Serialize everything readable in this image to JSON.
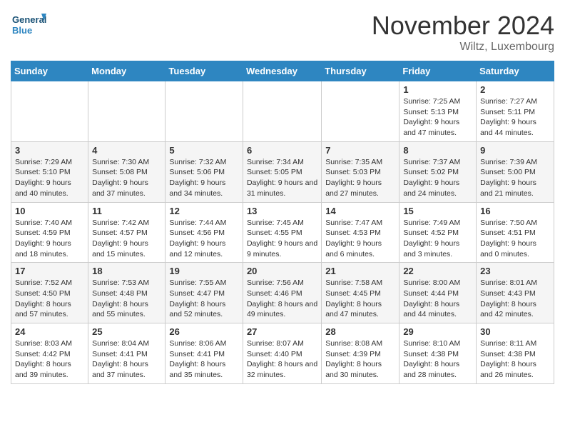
{
  "header": {
    "logo_line1": "General",
    "logo_line2": "Blue",
    "month_title": "November 2024",
    "location": "Wiltz, Luxembourg"
  },
  "weekdays": [
    "Sunday",
    "Monday",
    "Tuesday",
    "Wednesday",
    "Thursday",
    "Friday",
    "Saturday"
  ],
  "weeks": [
    [
      {
        "day": "",
        "info": ""
      },
      {
        "day": "",
        "info": ""
      },
      {
        "day": "",
        "info": ""
      },
      {
        "day": "",
        "info": ""
      },
      {
        "day": "",
        "info": ""
      },
      {
        "day": "1",
        "info": "Sunrise: 7:25 AM\nSunset: 5:13 PM\nDaylight: 9 hours and 47 minutes."
      },
      {
        "day": "2",
        "info": "Sunrise: 7:27 AM\nSunset: 5:11 PM\nDaylight: 9 hours and 44 minutes."
      }
    ],
    [
      {
        "day": "3",
        "info": "Sunrise: 7:29 AM\nSunset: 5:10 PM\nDaylight: 9 hours and 40 minutes."
      },
      {
        "day": "4",
        "info": "Sunrise: 7:30 AM\nSunset: 5:08 PM\nDaylight: 9 hours and 37 minutes."
      },
      {
        "day": "5",
        "info": "Sunrise: 7:32 AM\nSunset: 5:06 PM\nDaylight: 9 hours and 34 minutes."
      },
      {
        "day": "6",
        "info": "Sunrise: 7:34 AM\nSunset: 5:05 PM\nDaylight: 9 hours and 31 minutes."
      },
      {
        "day": "7",
        "info": "Sunrise: 7:35 AM\nSunset: 5:03 PM\nDaylight: 9 hours and 27 minutes."
      },
      {
        "day": "8",
        "info": "Sunrise: 7:37 AM\nSunset: 5:02 PM\nDaylight: 9 hours and 24 minutes."
      },
      {
        "day": "9",
        "info": "Sunrise: 7:39 AM\nSunset: 5:00 PM\nDaylight: 9 hours and 21 minutes."
      }
    ],
    [
      {
        "day": "10",
        "info": "Sunrise: 7:40 AM\nSunset: 4:59 PM\nDaylight: 9 hours and 18 minutes."
      },
      {
        "day": "11",
        "info": "Sunrise: 7:42 AM\nSunset: 4:57 PM\nDaylight: 9 hours and 15 minutes."
      },
      {
        "day": "12",
        "info": "Sunrise: 7:44 AM\nSunset: 4:56 PM\nDaylight: 9 hours and 12 minutes."
      },
      {
        "day": "13",
        "info": "Sunrise: 7:45 AM\nSunset: 4:55 PM\nDaylight: 9 hours and 9 minutes."
      },
      {
        "day": "14",
        "info": "Sunrise: 7:47 AM\nSunset: 4:53 PM\nDaylight: 9 hours and 6 minutes."
      },
      {
        "day": "15",
        "info": "Sunrise: 7:49 AM\nSunset: 4:52 PM\nDaylight: 9 hours and 3 minutes."
      },
      {
        "day": "16",
        "info": "Sunrise: 7:50 AM\nSunset: 4:51 PM\nDaylight: 9 hours and 0 minutes."
      }
    ],
    [
      {
        "day": "17",
        "info": "Sunrise: 7:52 AM\nSunset: 4:50 PM\nDaylight: 8 hours and 57 minutes."
      },
      {
        "day": "18",
        "info": "Sunrise: 7:53 AM\nSunset: 4:48 PM\nDaylight: 8 hours and 55 minutes."
      },
      {
        "day": "19",
        "info": "Sunrise: 7:55 AM\nSunset: 4:47 PM\nDaylight: 8 hours and 52 minutes."
      },
      {
        "day": "20",
        "info": "Sunrise: 7:56 AM\nSunset: 4:46 PM\nDaylight: 8 hours and 49 minutes."
      },
      {
        "day": "21",
        "info": "Sunrise: 7:58 AM\nSunset: 4:45 PM\nDaylight: 8 hours and 47 minutes."
      },
      {
        "day": "22",
        "info": "Sunrise: 8:00 AM\nSunset: 4:44 PM\nDaylight: 8 hours and 44 minutes."
      },
      {
        "day": "23",
        "info": "Sunrise: 8:01 AM\nSunset: 4:43 PM\nDaylight: 8 hours and 42 minutes."
      }
    ],
    [
      {
        "day": "24",
        "info": "Sunrise: 8:03 AM\nSunset: 4:42 PM\nDaylight: 8 hours and 39 minutes."
      },
      {
        "day": "25",
        "info": "Sunrise: 8:04 AM\nSunset: 4:41 PM\nDaylight: 8 hours and 37 minutes."
      },
      {
        "day": "26",
        "info": "Sunrise: 8:06 AM\nSunset: 4:41 PM\nDaylight: 8 hours and 35 minutes."
      },
      {
        "day": "27",
        "info": "Sunrise: 8:07 AM\nSunset: 4:40 PM\nDaylight: 8 hours and 32 minutes."
      },
      {
        "day": "28",
        "info": "Sunrise: 8:08 AM\nSunset: 4:39 PM\nDaylight: 8 hours and 30 minutes."
      },
      {
        "day": "29",
        "info": "Sunrise: 8:10 AM\nSunset: 4:38 PM\nDaylight: 8 hours and 28 minutes."
      },
      {
        "day": "30",
        "info": "Sunrise: 8:11 AM\nSunset: 4:38 PM\nDaylight: 8 hours and 26 minutes."
      }
    ]
  ]
}
